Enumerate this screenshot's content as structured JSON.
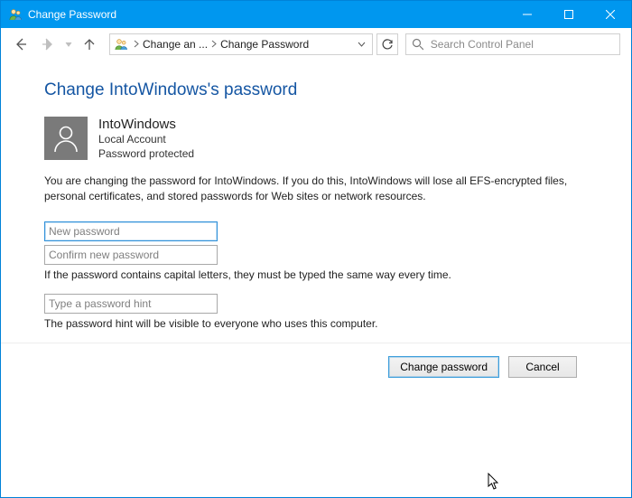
{
  "window": {
    "title": "Change Password"
  },
  "breadcrumb": {
    "item1": "Change an ...",
    "item2": "Change Password"
  },
  "search": {
    "placeholder": "Search Control Panel"
  },
  "page": {
    "heading": "Change IntoWindows's password"
  },
  "user": {
    "name": "IntoWindows",
    "type": "Local Account",
    "status": "Password protected"
  },
  "warning": "You are changing the password for IntoWindows.  If you do this, IntoWindows will lose all EFS-encrypted files, personal certificates, and stored passwords for Web sites or network resources.",
  "fields": {
    "new_password_placeholder": "New password",
    "confirm_password_placeholder": "Confirm new password",
    "hint_placeholder": "Type a password hint"
  },
  "hints": {
    "caps_notice": "If the password contains capital letters, they must be typed the same way every time.",
    "visibility_notice": "The password hint will be visible to everyone who uses this computer."
  },
  "buttons": {
    "change": "Change password",
    "cancel": "Cancel"
  }
}
